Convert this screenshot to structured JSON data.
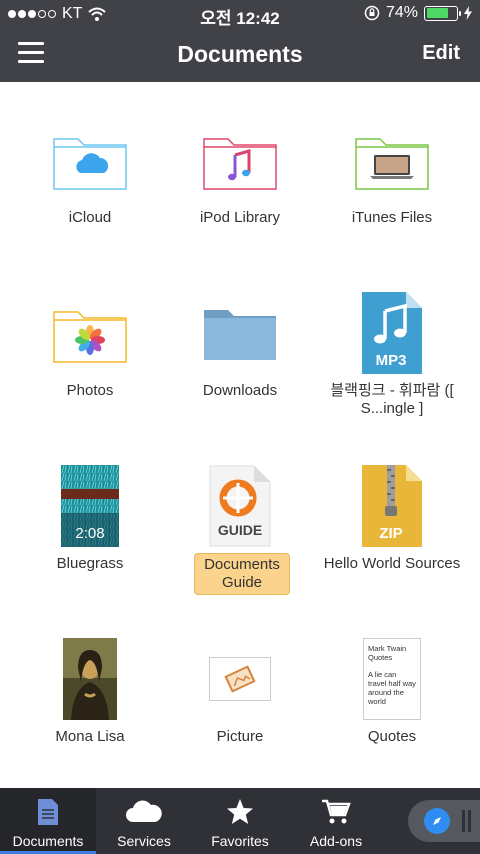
{
  "status": {
    "carrier": "KT",
    "time": "오전 12:42",
    "battery": "74%",
    "battery_level": 0.74
  },
  "nav": {
    "title": "Documents",
    "edit_label": "Edit"
  },
  "items": [
    {
      "label": "iCloud",
      "icon": "icloud-folder-icon"
    },
    {
      "label": "iPod Library",
      "icon": "music-folder-icon"
    },
    {
      "label": "iTunes Files",
      "icon": "computer-folder-icon"
    },
    {
      "label": "Photos",
      "icon": "photos-folder-icon"
    },
    {
      "label": "Downloads",
      "icon": "folder-icon"
    },
    {
      "label": "블랙핑크 - 휘파람 ([ S...ingle ]",
      "icon": "mp3-file-icon",
      "badge": "MP3"
    },
    {
      "label": "Bluegrass",
      "icon": "video-thumbnail-icon",
      "duration": "2:08"
    },
    {
      "label": "Documents Guide",
      "icon": "guide-file-icon",
      "badge": "GUIDE",
      "selected": true
    },
    {
      "label": "Hello World Sources",
      "icon": "zip-file-icon",
      "badge": "ZIP"
    },
    {
      "label": "Mona Lisa",
      "icon": "image-thumbnail-icon"
    },
    {
      "label": "Picture",
      "icon": "picture-file-icon"
    },
    {
      "label": "Quotes",
      "icon": "text-file-icon",
      "preview_title": "Mark Twain Quotes",
      "preview_body": "A lie can travel half way around the world"
    }
  ],
  "tabs": [
    {
      "label": "Documents",
      "icon": "document-icon",
      "active": true
    },
    {
      "label": "Services",
      "icon": "cloud-icon"
    },
    {
      "label": "Favorites",
      "icon": "star-icon"
    },
    {
      "label": "Add-ons",
      "icon": "cart-icon"
    }
  ],
  "colors": {
    "header": "#404247",
    "tabbar": "#2f3136",
    "accent": "#3d7fe0",
    "selection": "#fbd38d"
  }
}
